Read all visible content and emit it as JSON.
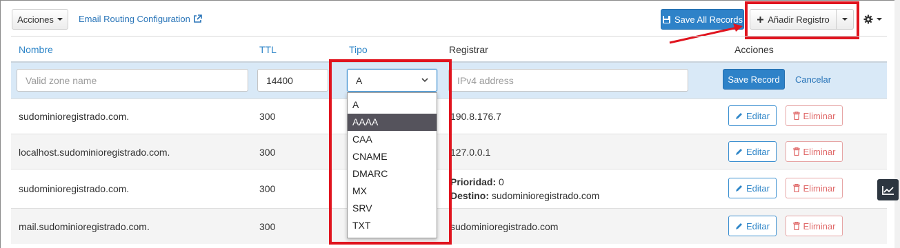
{
  "toolbar": {
    "actions_label": "Acciones",
    "email_routing_label": "Email Routing Configuration",
    "save_all_label": "Save All Records",
    "add_record_label": "Añadir Registro"
  },
  "table": {
    "headers": {
      "name": "Nombre",
      "ttl": "TTL",
      "type": "Tipo",
      "record": "Registrar",
      "actions": "Acciones"
    }
  },
  "edit_row": {
    "name_placeholder": "Valid zone name",
    "ttl_value": "14400",
    "type_value": "A",
    "record_placeholder": "IPv4 address",
    "save_label": "Save Record",
    "cancel_label": "Cancelar"
  },
  "type_options": [
    "A",
    "AAAA",
    "CAA",
    "CNAME",
    "DMARC",
    "MX",
    "SRV",
    "TXT"
  ],
  "type_selected": "AAAA",
  "rows": [
    {
      "name": "sudominioregistrado.com.",
      "ttl": "300",
      "record": "190.8.176.7"
    },
    {
      "name": "localhost.sudominioregistrado.com.",
      "ttl": "300",
      "record": "127.0.0.1"
    },
    {
      "name": "sudominioregistrado.com.",
      "ttl": "300",
      "priority_label": "Prioridad:",
      "priority_value": "0",
      "dest_label": "Destino:",
      "dest_value": "sudominioregistrado.com"
    },
    {
      "name": "mail.sudominioregistrado.com.",
      "ttl": "300",
      "record": "sudominioregistrado.com"
    }
  ],
  "row_actions": {
    "edit_label": "Editar",
    "delete_label": "Eliminar"
  },
  "colors": {
    "primary": "#2e82c8",
    "link": "#2f86c8",
    "danger": "#e06a6a",
    "highlight": "#e0141e",
    "edit_row_bg": "#d9e9f7"
  }
}
